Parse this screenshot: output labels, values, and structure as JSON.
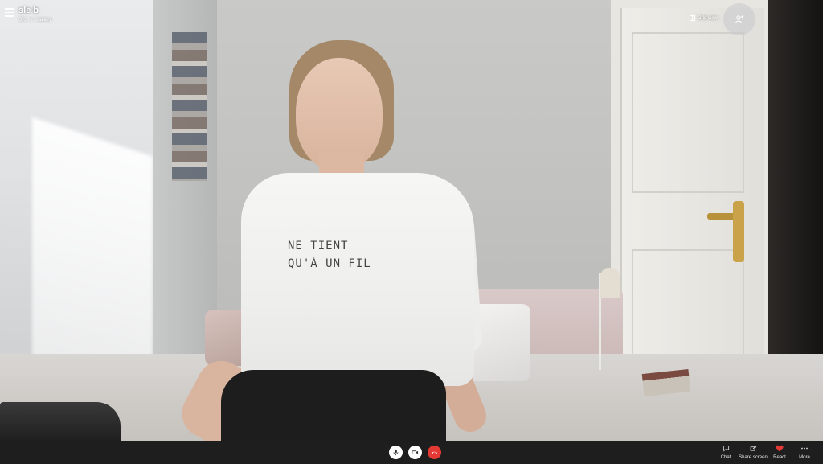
{
  "header": {
    "title": "sle b",
    "subtitle": "ﾛ00 | ☆ Gallery",
    "grid_view_label": "Grid view"
  },
  "call_controls": {
    "mic": "microphone",
    "video": "camera",
    "hangup": "end-call"
  },
  "toolbar": {
    "chat_label": "Chat",
    "share_label": "Share screen",
    "react_label": "React",
    "more_label": "More"
  },
  "shirt_text": {
    "line1": "NE TIENT",
    "line2": "QU'À UN FIL"
  },
  "colors": {
    "hangup": "#e53935",
    "react_heart": "#e53935",
    "bar": "#1e1e1e"
  }
}
